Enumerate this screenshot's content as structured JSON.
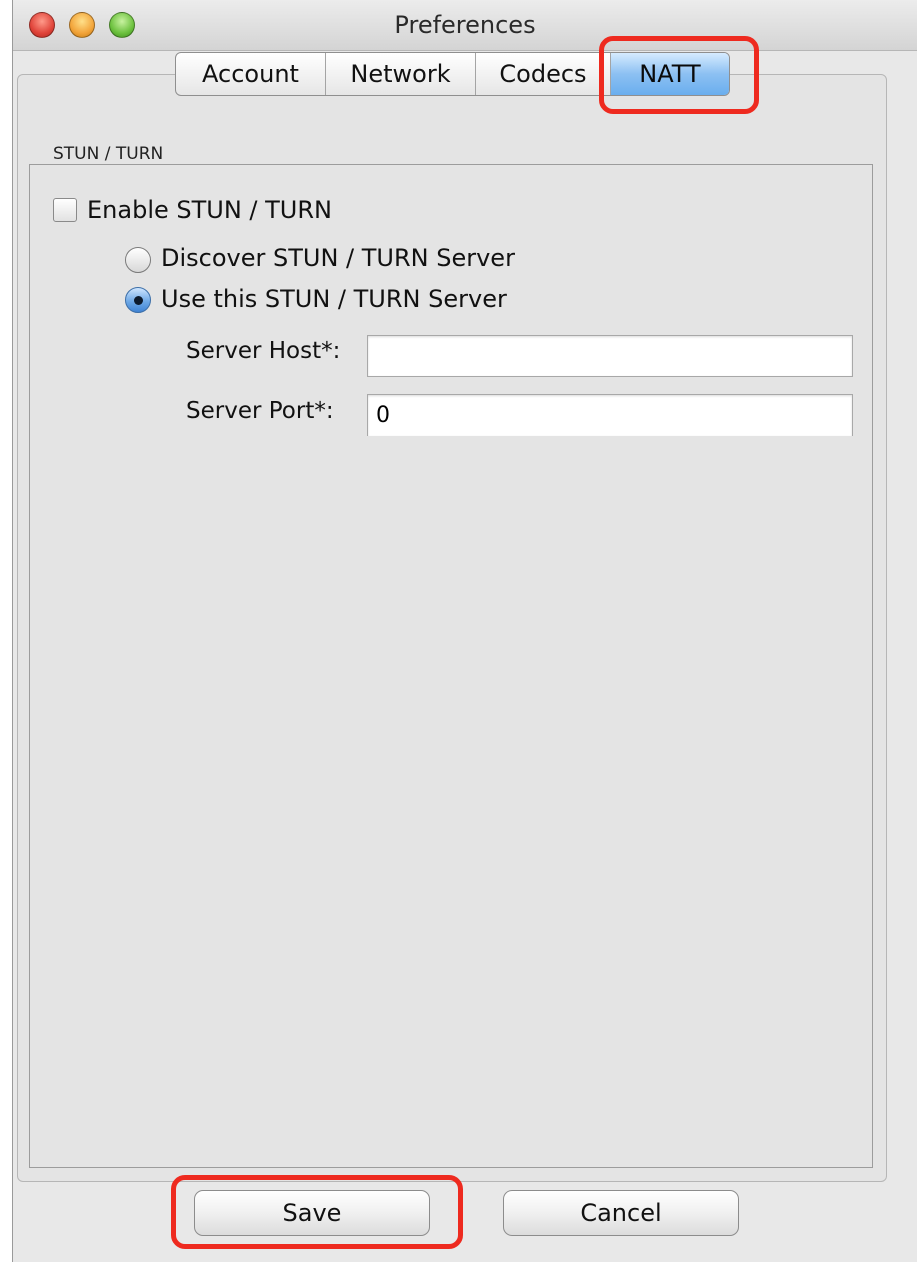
{
  "window": {
    "title": "Preferences"
  },
  "tabs": [
    {
      "label": "Account"
    },
    {
      "label": "Network"
    },
    {
      "label": "Codecs"
    },
    {
      "label": "NATT",
      "selected": true
    }
  ],
  "group": {
    "title": "STUN / TURN",
    "enable_label": "Enable STUN / TURN",
    "enable_checked": false,
    "radio_options": [
      {
        "label": "Discover STUN / TURN Server",
        "selected": false
      },
      {
        "label": "Use this STUN / TURN Server",
        "selected": true
      }
    ],
    "host_label": "Server Host*:",
    "host_value": "",
    "port_label": "Server Port*:",
    "port_value": "0"
  },
  "buttons": {
    "save_label": "Save",
    "cancel_label": "Cancel"
  },
  "colors": {
    "highlight": "#ee2a1f",
    "active_tab": "#6aaeee"
  }
}
